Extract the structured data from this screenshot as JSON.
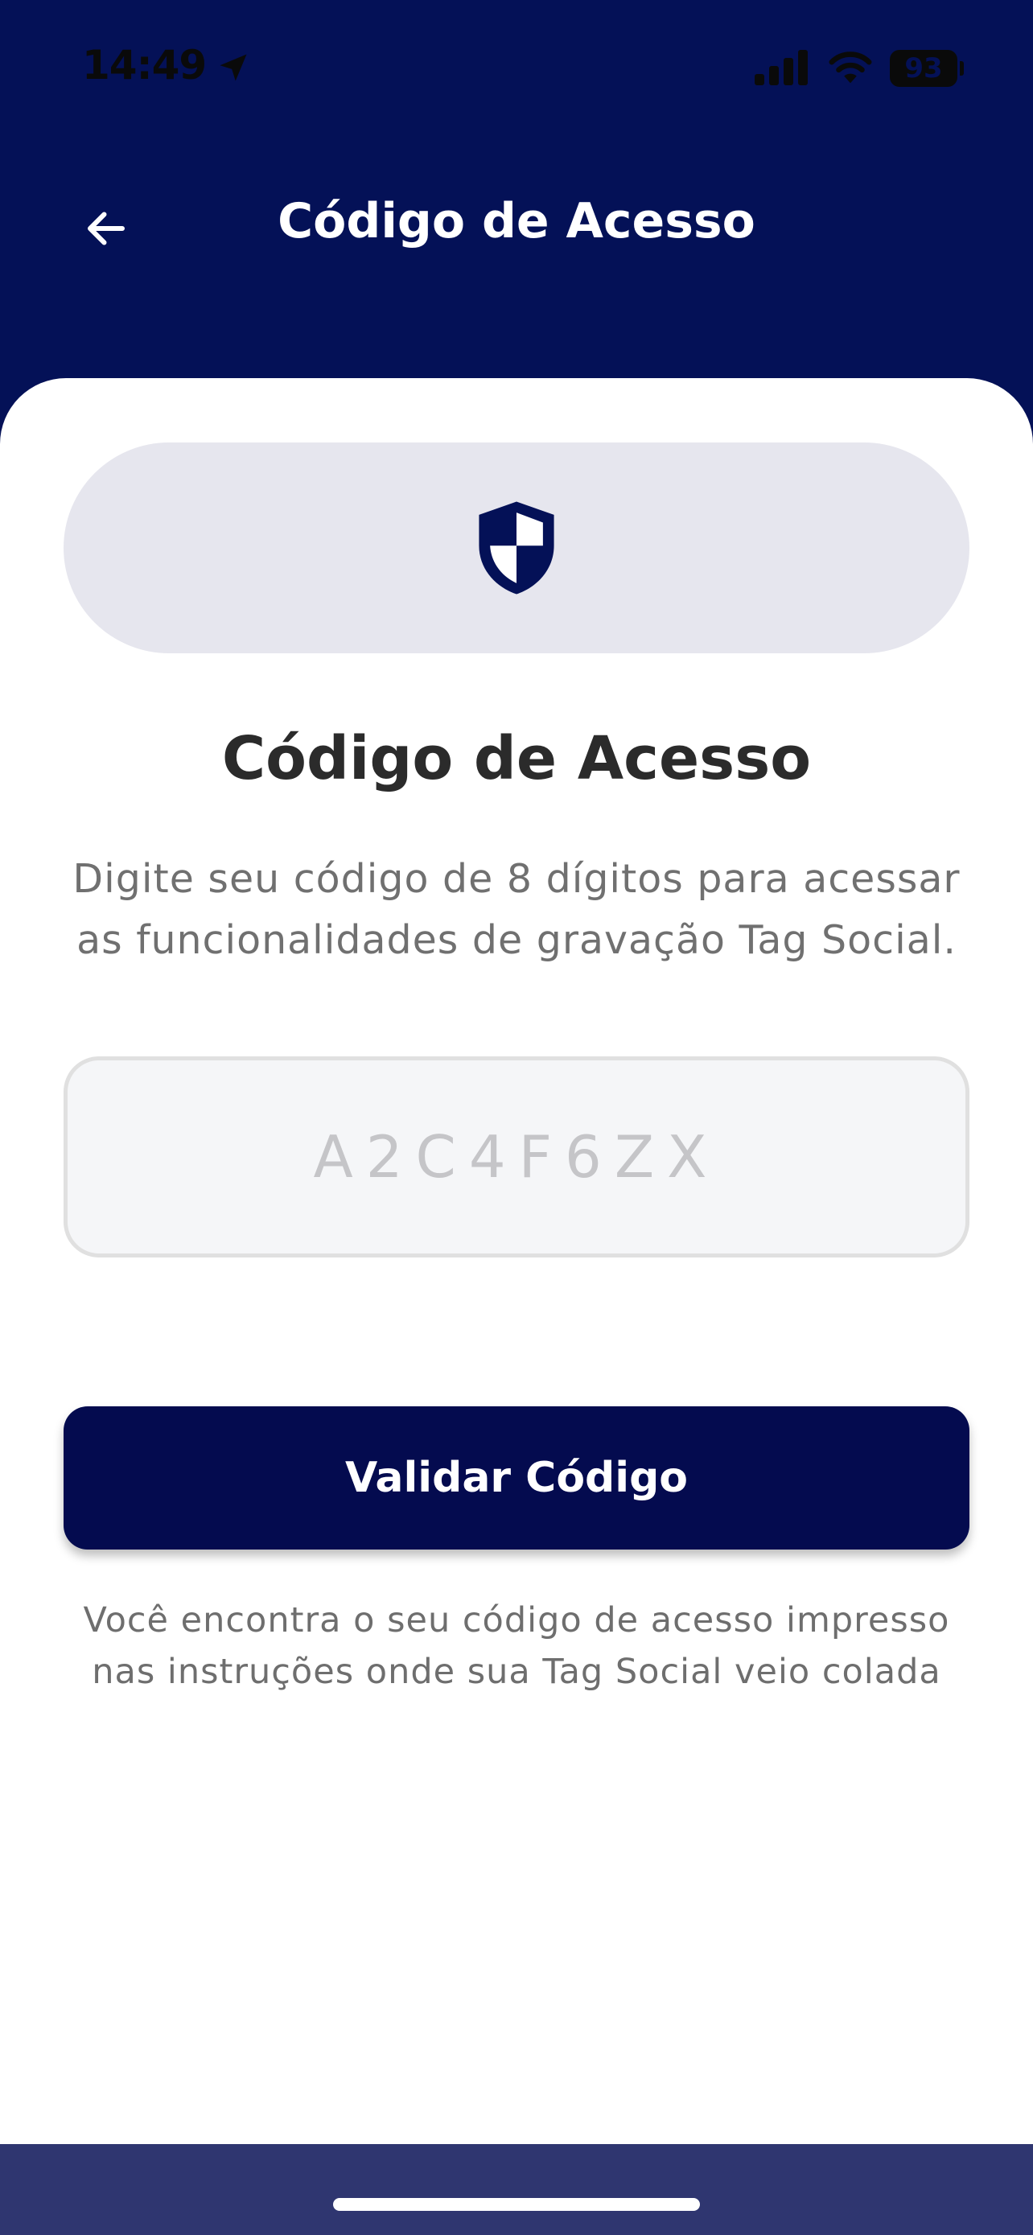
{
  "status_bar": {
    "time": "14:49",
    "battery": "93",
    "icons": [
      "location-arrow-icon",
      "cellular-signal-icon",
      "wifi-icon",
      "battery-icon"
    ]
  },
  "header": {
    "title": "Código de Acesso",
    "back_icon": "arrow-left-icon"
  },
  "main": {
    "shield_icon": "shield-icon",
    "heading": "Código de Acesso",
    "description": "Digite seu código de 8 dígitos para acessar as funcionalidades de gravação Tag Social.",
    "code_input": {
      "value": "",
      "placeholder": "A2C4F6ZX"
    },
    "validate_label": "Validar Código",
    "help_text": "Você encontra o seu código de acesso impresso nas instruções onde sua Tag Social veio colada"
  },
  "colors": {
    "header_bg": "#041157",
    "primary_button": "#040b4f",
    "pill_bg": "#e6e6ee",
    "bottom_bar": "#2f3670"
  }
}
